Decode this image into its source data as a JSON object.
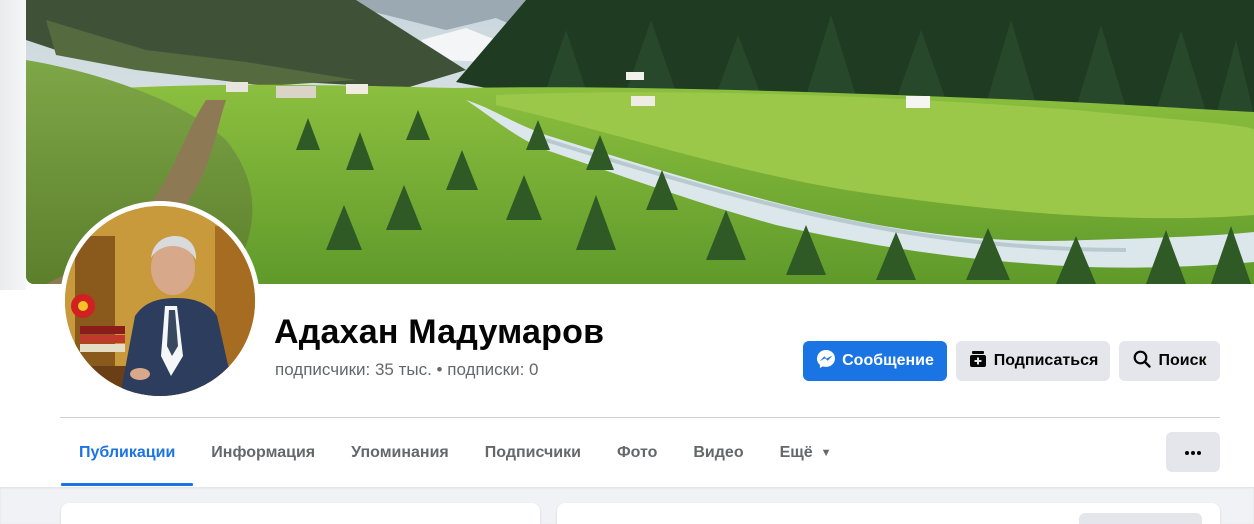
{
  "profile": {
    "name": "Адахан Мадумаров",
    "followers": "подписчики: 35 тыс.",
    "separator": "•",
    "following": "подписки: 0"
  },
  "actions": {
    "message_label": "Сообщение",
    "subscribe_label": "Подписаться",
    "search_label": "Поиск"
  },
  "tabs": [
    {
      "label": "Публикации",
      "active": true
    },
    {
      "label": "Информация"
    },
    {
      "label": "Упоминания"
    },
    {
      "label": "Подписчики"
    },
    {
      "label": "Фото"
    },
    {
      "label": "Видео"
    },
    {
      "label": "Ещё",
      "dropdown": true
    }
  ],
  "more_menu_icon": "ellipsis-icon",
  "colors": {
    "accent": "#1b74e4",
    "secondary_button": "#e4e6eb",
    "muted_text": "#65676b"
  }
}
